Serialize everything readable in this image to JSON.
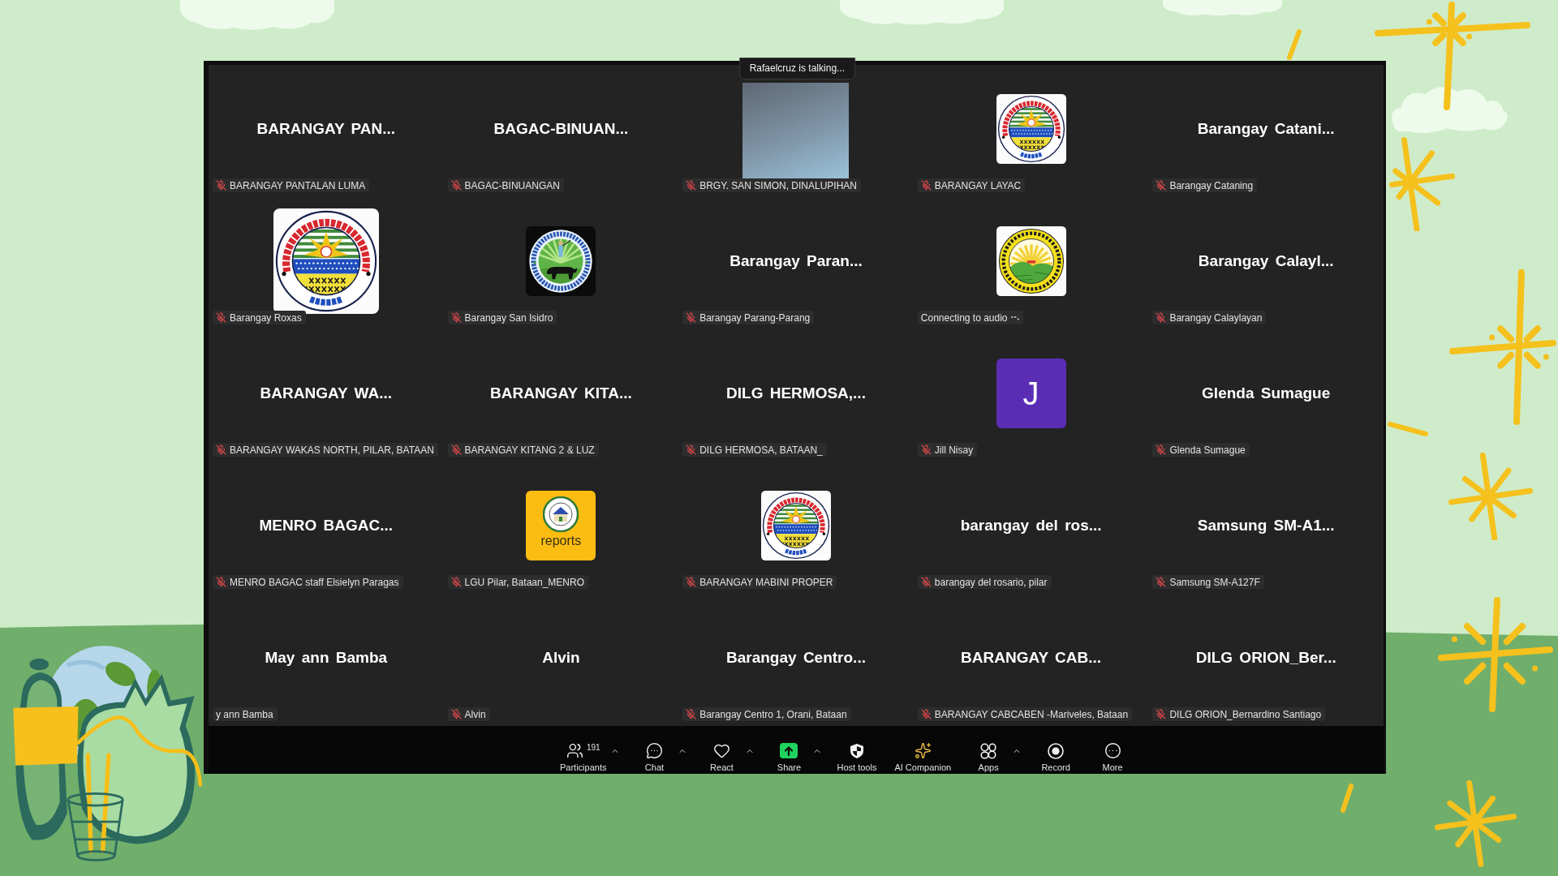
{
  "meeting": {
    "speaker_notice": "Rafaelcruz is talking...",
    "tiles": [
      {
        "kind": "name",
        "name": "BARANGAY PAN...",
        "label": "BARANGAY PANTALAN LUMA",
        "muted": true,
        "connecting": false
      },
      {
        "kind": "name",
        "name": "BAGAC-BINUAN...",
        "label": "BAGAC-BINUANGAN",
        "muted": true,
        "connecting": false
      },
      {
        "kind": "video",
        "label": "BRGY. SAN SIMON, DINALUPIHAN",
        "muted": true,
        "connecting": false
      },
      {
        "kind": "striped-seal",
        "label": "BARANGAY LAYAC",
        "muted": true,
        "connecting": false
      },
      {
        "kind": "name",
        "name": "Barangay Catani...",
        "label": "Barangay Cataning",
        "muted": true,
        "connecting": false
      },
      {
        "kind": "striped-seal-large",
        "label": "Barangay Roxas",
        "muted": true,
        "connecting": false
      },
      {
        "kind": "carabao-seal",
        "label": "Barangay San Isidro",
        "muted": true,
        "connecting": false
      },
      {
        "kind": "name",
        "name": "Barangay Paran...",
        "label": "Barangay Parang-Parang",
        "muted": true,
        "connecting": false
      },
      {
        "kind": "sunburst-seal",
        "label": "Connecting to audio",
        "muted": false,
        "connecting": true
      },
      {
        "kind": "name",
        "name": "Barangay Calayl...",
        "label": "Barangay Calaylayan",
        "muted": true,
        "connecting": false
      },
      {
        "kind": "name",
        "name": "BARANGAY WA...",
        "label": "BARANGAY WAKAS NORTH, PILAR, BATAAN",
        "muted": true,
        "connecting": false
      },
      {
        "kind": "name",
        "name": "BARANGAY KITA...",
        "label": "BARANGAY KITANG 2 & LUZ",
        "muted": true,
        "connecting": false
      },
      {
        "kind": "name",
        "name": "DILG HERMOSA,...",
        "label": "DILG HERMOSA, BATAAN_",
        "muted": true,
        "connecting": false
      },
      {
        "kind": "initial",
        "initial": "J",
        "label": "Jill Nisay",
        "muted": true,
        "connecting": false
      },
      {
        "kind": "name",
        "name": "Glenda Sumague",
        "label": "Glenda Sumague",
        "muted": true,
        "connecting": false
      },
      {
        "kind": "name",
        "name": "MENRO BAGAC...",
        "label": "MENRO BAGAC staff Elsielyn Paragas",
        "muted": true,
        "connecting": false
      },
      {
        "kind": "caption-badge",
        "caption": "reports",
        "label": "LGU Pilar, Bataan_MENRO",
        "muted": true,
        "connecting": false
      },
      {
        "kind": "striped-seal",
        "label": "BARANGAY MABINI PROPER",
        "muted": true,
        "connecting": false
      },
      {
        "kind": "name",
        "name": "barangay del ros...",
        "label": "barangay del rosario, pilar",
        "muted": true,
        "connecting": false
      },
      {
        "kind": "name",
        "name": "Samsung SM-A1...",
        "label": "Samsung SM-A127F",
        "muted": true,
        "connecting": false
      },
      {
        "kind": "name",
        "name": "May ann Bamba",
        "label": "y ann Bamba",
        "muted": false,
        "connecting": false
      },
      {
        "kind": "name",
        "name": "Alvin",
        "label": "Alvin",
        "muted": true,
        "connecting": false
      },
      {
        "kind": "name",
        "name": "Barangay Centro...",
        "label": "Barangay Centro 1, Orani, Bataan",
        "muted": true,
        "connecting": false
      },
      {
        "kind": "name",
        "name": "BARANGAY CAB...",
        "label": "BARANGAY CABCABEN -Mariveles, Bataan",
        "muted": true,
        "connecting": false
      },
      {
        "kind": "name",
        "name": "DILG ORION_Ber...",
        "label": "DILG ORION_Bernardino Santiago",
        "muted": true,
        "connecting": false
      }
    ]
  },
  "toolbar": {
    "items": [
      {
        "kind": "participants",
        "label": "Participants",
        "count": "191",
        "menu": true
      },
      {
        "kind": "chat",
        "label": "Chat",
        "menu": true
      },
      {
        "kind": "react",
        "label": "React",
        "menu": true
      },
      {
        "kind": "share",
        "label": "Share",
        "menu": true
      },
      {
        "kind": "host-tools",
        "label": "Host tools",
        "menu": false
      },
      {
        "kind": "ai-companion",
        "label": "AI Companion",
        "menu": false
      },
      {
        "kind": "apps",
        "label": "Apps",
        "menu": true
      },
      {
        "kind": "record",
        "label": "Record",
        "menu": false
      },
      {
        "kind": "more",
        "label": "More",
        "menu": false
      }
    ]
  }
}
